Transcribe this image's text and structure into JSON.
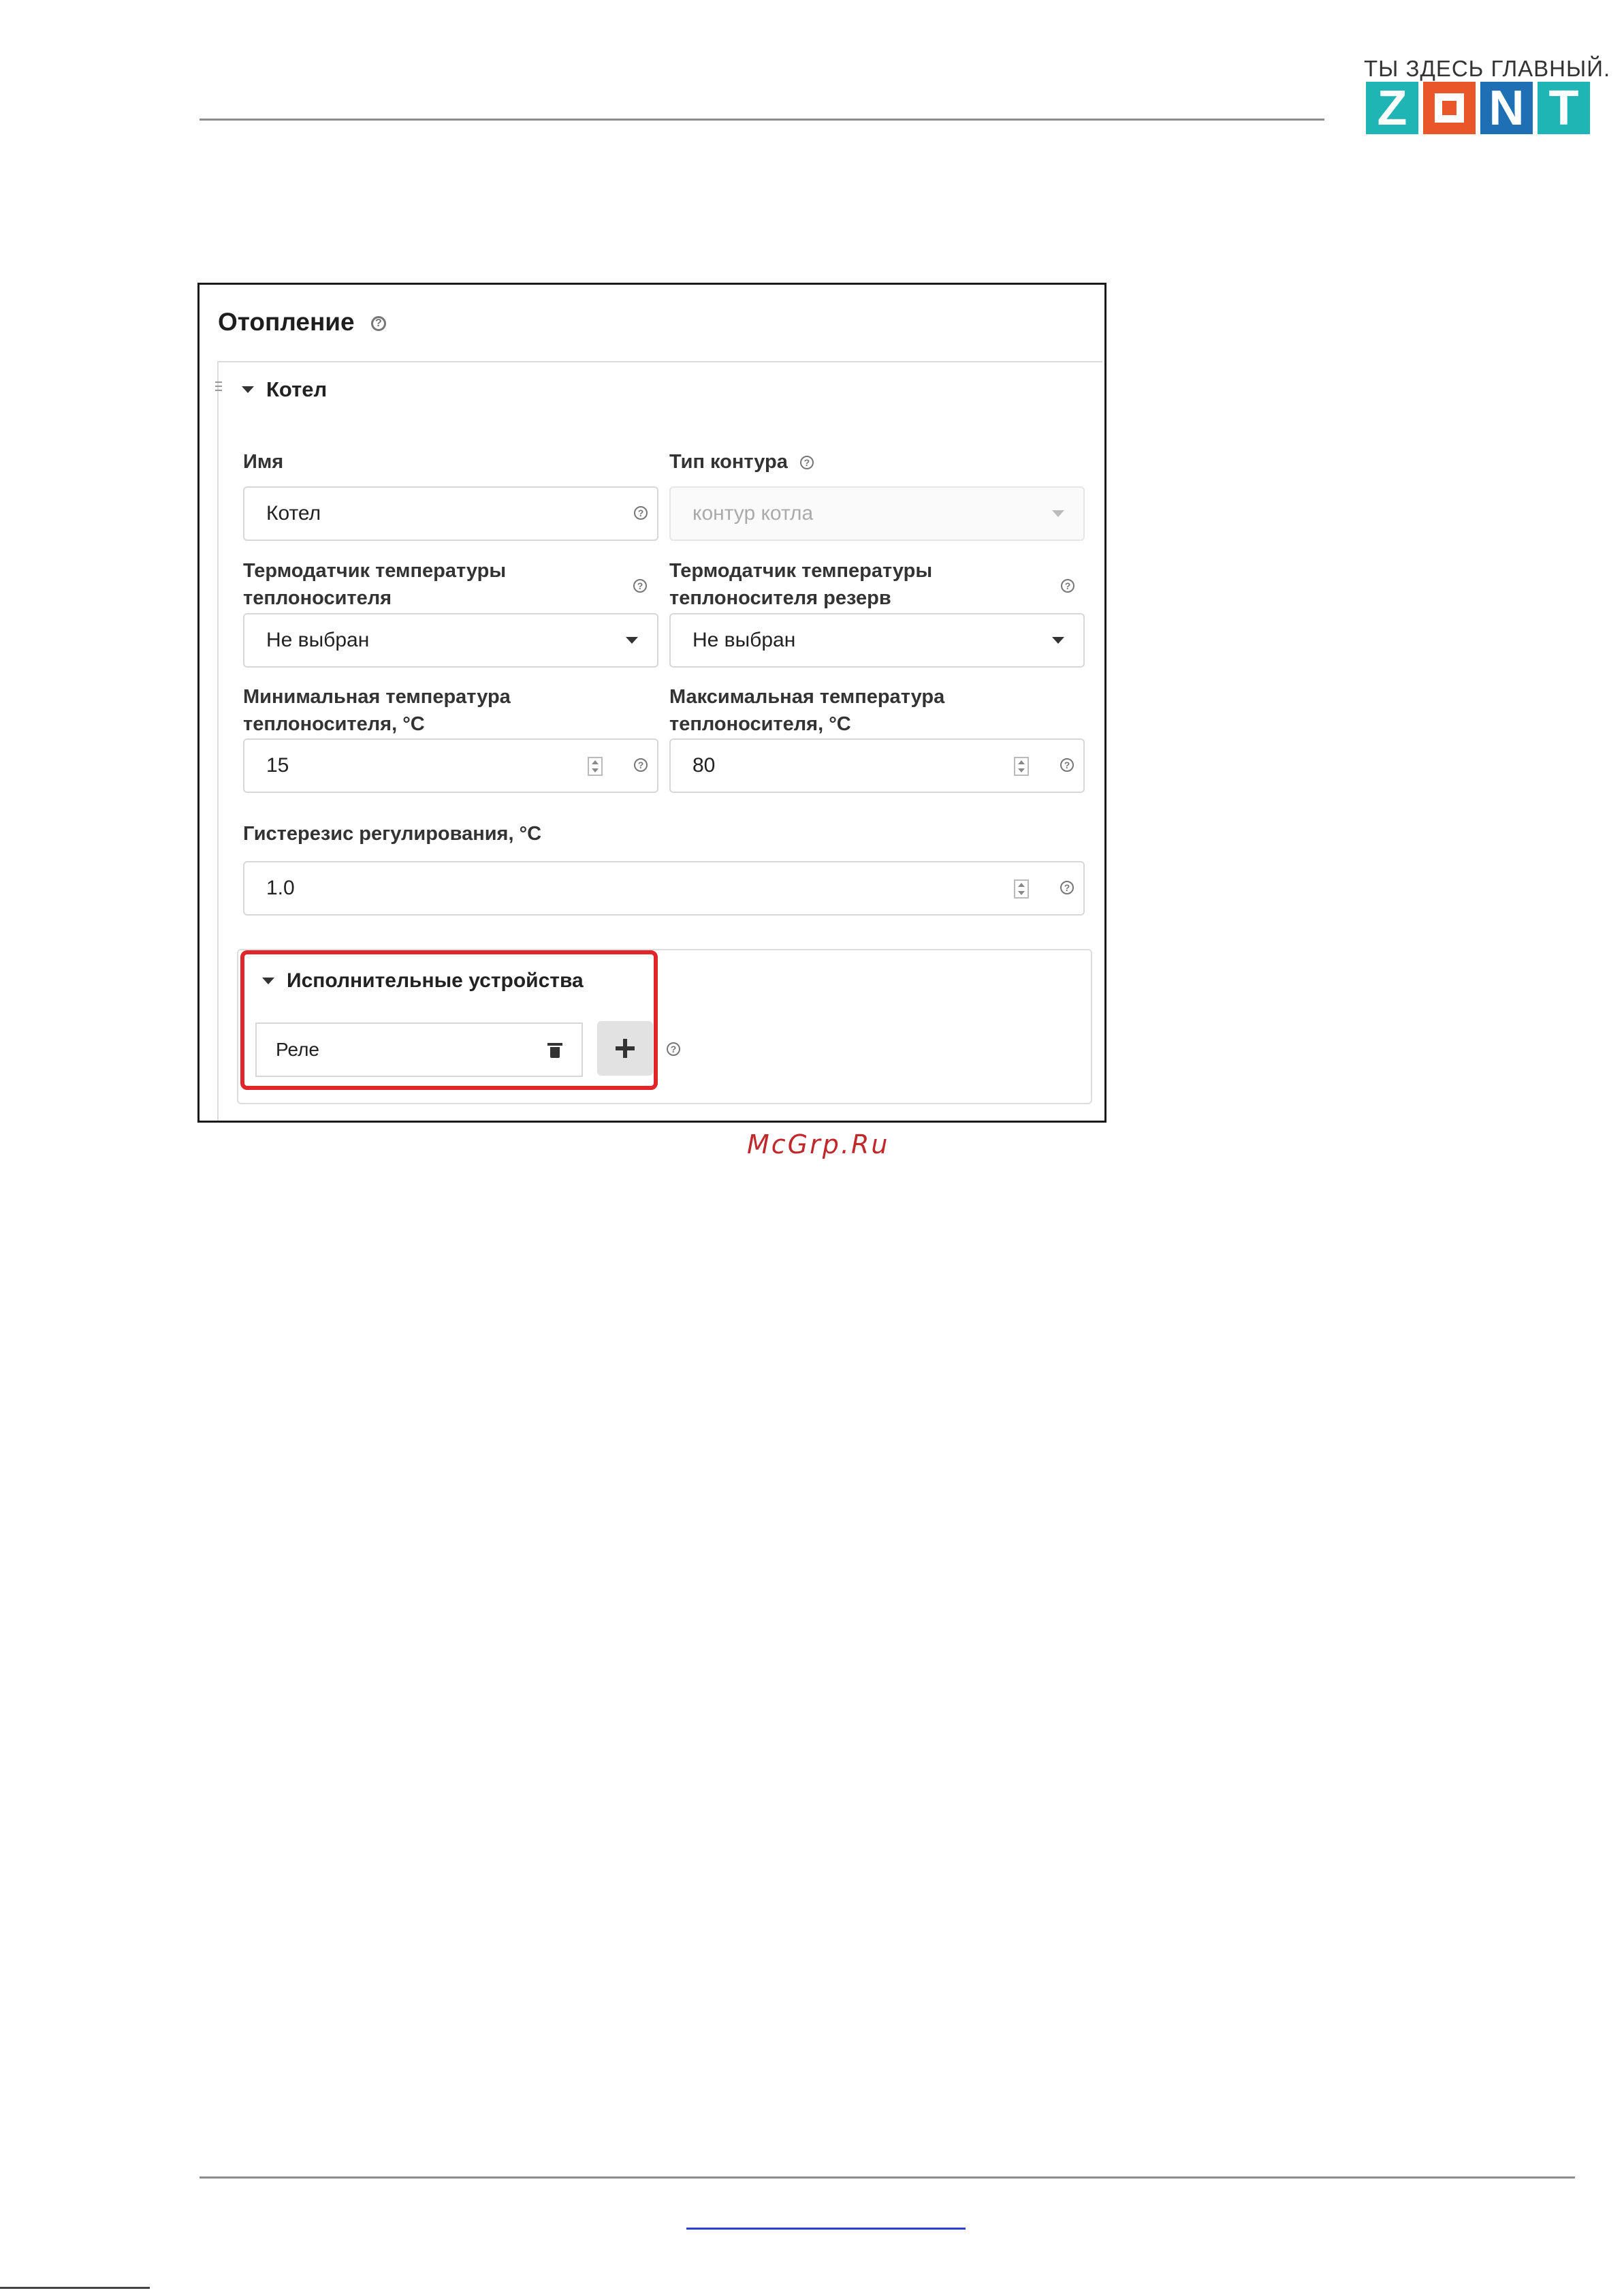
{
  "logo": {
    "tagline": "ТЫ ЗДЕСЬ ГЛАВНЫЙ.",
    "letters": [
      "Z",
      "O",
      "N",
      "T"
    ],
    "colors": {
      "teal": "#1fb5b5",
      "orange": "#e8562a",
      "blue": "#1e6fb3"
    }
  },
  "form": {
    "title": "Отопление",
    "section": {
      "title": "Котел",
      "name": {
        "label": "Имя",
        "value": "Котел"
      },
      "circuit_type": {
        "label": "Тип контура",
        "value": "контур котла"
      },
      "sensor": {
        "label_line1": "Термодатчик температуры",
        "label_line2": "теплоносителя",
        "value": "Не выбран"
      },
      "sensor_reserve": {
        "label_line1": "Термодатчик температуры",
        "label_line2": "теплоносителя резерв",
        "value": "Не выбран"
      },
      "min_temp": {
        "label_line1": "Минимальная температура",
        "label_line2": "теплоносителя, °C",
        "value": "15"
      },
      "max_temp": {
        "label_line1": "Максимальная температура",
        "label_line2": "теплоносителя, °C",
        "value": "80"
      },
      "hysteresis": {
        "label": "Гистерезис регулирования, °C",
        "value": "1.0"
      },
      "actuators": {
        "title": "Исполнительные устройства",
        "items": [
          {
            "label": "Реле"
          }
        ]
      }
    }
  },
  "watermark": "McGrp.Ru",
  "icons": {
    "help": "?",
    "help_icon": "help-icon",
    "caret": "caret-down-icon",
    "trash": "trash-icon",
    "add": "plus-icon",
    "drag": "drag-handle-icon",
    "spinner": "spinner-icon"
  },
  "accent_color": "#e0262b"
}
